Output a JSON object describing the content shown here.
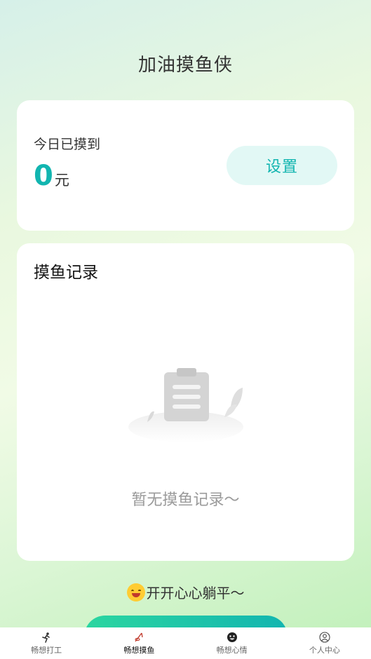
{
  "header": {
    "title": "加油摸鱼侠"
  },
  "stats": {
    "label": "今日已摸到",
    "amount": "0",
    "unit": "元",
    "settings_label": "设置"
  },
  "records": {
    "title": "摸鱼记录",
    "empty_text": "暂无摸鱼记录～"
  },
  "footer": {
    "message": "开开心心躺平～"
  },
  "tabs": [
    {
      "label": "畅想打工",
      "icon": "runner-icon",
      "active": false
    },
    {
      "label": "畅想摸鱼",
      "icon": "fishing-icon",
      "active": true
    },
    {
      "label": "畅想心情",
      "icon": "mood-face-icon",
      "active": false
    },
    {
      "label": "个人中心",
      "icon": "user-profile-icon",
      "active": false
    }
  ],
  "colors": {
    "accent": "#12b5b0",
    "accent_light": "#e2f8f5"
  }
}
